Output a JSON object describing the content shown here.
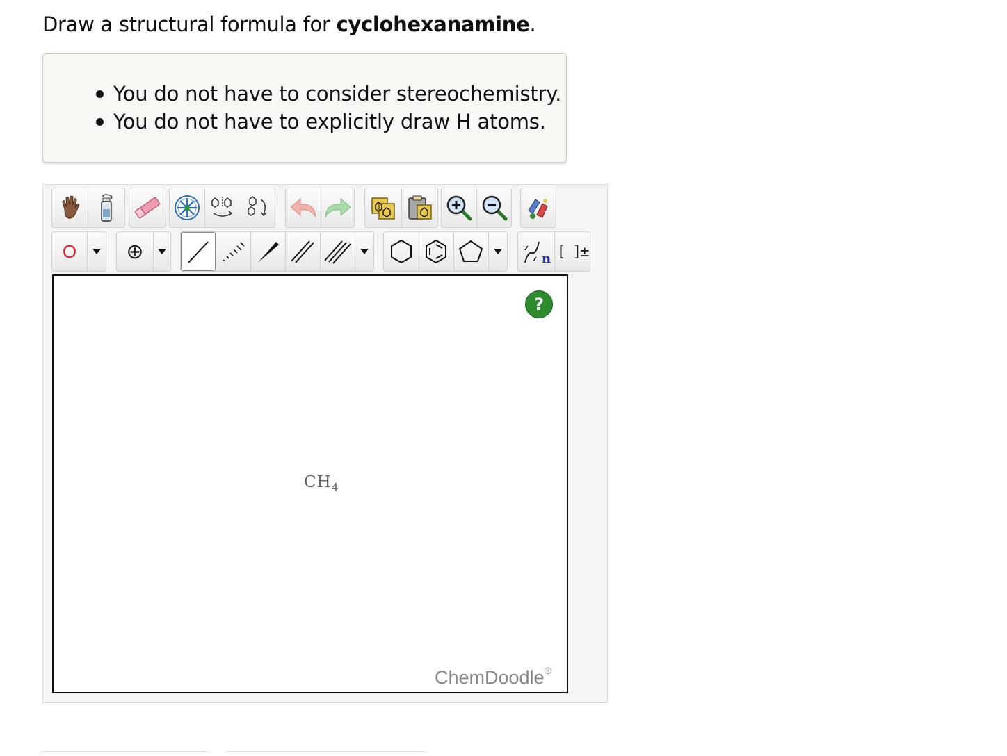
{
  "question": {
    "prefix": "Draw a structural formula for ",
    "compound": "cyclohexanamine",
    "suffix": "."
  },
  "hints": [
    "You do not have to consider stereochemistry.",
    "You do not have to explicitly draw H atoms."
  ],
  "toolbar": {
    "row1": [
      "hand-icon",
      "clear-bottle-icon",
      "eraser-icon",
      "center-molecule-icon",
      "flip-icon",
      "rotate-icon",
      "undo-icon",
      "redo-icon",
      "copy-icon",
      "paste-icon",
      "zoom-in-icon",
      "zoom-out-icon",
      "clean-icon"
    ],
    "atom_label": "O",
    "atom_color": "#e0202a",
    "charge_label": "⊕",
    "bracket_label": "[ ]±",
    "repeat_label": "n"
  },
  "canvas": {
    "molecule": "CH",
    "subscript": "4",
    "help_label": "?",
    "brand": "ChemDoodle",
    "brand_mark": "®"
  }
}
